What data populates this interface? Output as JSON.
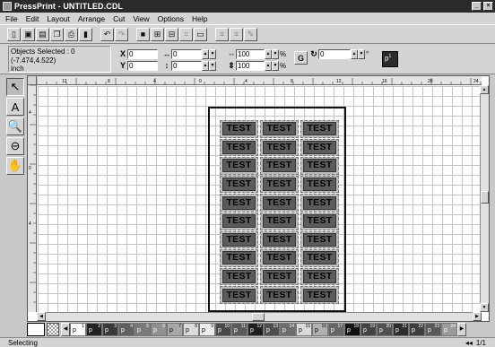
{
  "window": {
    "title": "PressPrint - UNTITLED.CDL",
    "minimize": "_",
    "close": "×"
  },
  "menu": [
    {
      "label": "File"
    },
    {
      "label": "Edit"
    },
    {
      "label": "Layout"
    },
    {
      "label": "Arrange"
    },
    {
      "label": "Cut"
    },
    {
      "label": "View"
    },
    {
      "label": "Options"
    },
    {
      "label": "Help"
    }
  ],
  "toolbar": {
    "icons": [
      "new-file-icon",
      "save-icon",
      "open-icon",
      "copy-icon",
      "print-icon",
      "clipboard-icon",
      "undo-icon",
      "redo-icon",
      "zoom-in-icon",
      "zoom-out-icon",
      "zoom-fit-icon",
      "group-icon",
      "frame-icon",
      "align-left-icon",
      "align-right-icon",
      "help-icon"
    ]
  },
  "properties": {
    "objects_selected": "Objects Selected : 0",
    "coords": "(-7.474,4.522)",
    "units": "inch",
    "x_label": "X",
    "x_value": "0",
    "y_label": "Y",
    "y_value": "0",
    "w_value": "0",
    "h_value": "0",
    "scale_w": "100",
    "scale_h": "100",
    "pct": "%",
    "lock_label": "G",
    "rotation": "0",
    "rotation_deg": "°"
  },
  "page_chip": {
    "label": "p",
    "number": "1"
  },
  "tools": [
    {
      "name": "pointer-tool-icon",
      "glyph": "↖",
      "active": true
    },
    {
      "name": "text-tool-icon",
      "glyph": "A",
      "active": false
    },
    {
      "name": "zoom-tool-icon",
      "glyph": "🔍",
      "active": false
    },
    {
      "name": "zoom-out-tool-icon",
      "glyph": "⊖",
      "active": false
    },
    {
      "name": "hand-tool-icon",
      "glyph": "✋",
      "active": false
    }
  ],
  "rulers": {
    "h_ticks": [
      "12",
      "8",
      "4",
      "0",
      "4",
      "8",
      "12",
      "16",
      "20",
      "24"
    ],
    "v_ticks": [
      "4",
      "0",
      "4"
    ]
  },
  "labels": {
    "text": "TEST",
    "rows": 10,
    "cols": 3
  },
  "palette": [
    {
      "num": "1",
      "color": "#ffffff"
    },
    {
      "num": "2",
      "color": "#222222"
    },
    {
      "num": "3",
      "color": "#3a3a3a"
    },
    {
      "num": "4",
      "color": "#606060"
    },
    {
      "num": "5",
      "color": "#7a7a7a"
    },
    {
      "num": "6",
      "color": "#909090"
    },
    {
      "num": "7",
      "color": "#a8a8a8"
    },
    {
      "num": "8",
      "color": "#dcdcdc"
    },
    {
      "num": "9",
      "color": "#ececec"
    },
    {
      "num": "10",
      "color": "#4a4a4a"
    },
    {
      "num": "11",
      "color": "#5a5a5a"
    },
    {
      "num": "12",
      "color": "#1e1e1e"
    },
    {
      "num": "13",
      "color": "#4e4e4e"
    },
    {
      "num": "14",
      "color": "#6e6e6e"
    },
    {
      "num": "15",
      "color": "#dadada"
    },
    {
      "num": "16",
      "color": "#b0b0b0"
    },
    {
      "num": "17",
      "color": "#666666"
    },
    {
      "num": "18",
      "color": "#111111"
    },
    {
      "num": "19",
      "color": "#444444"
    },
    {
      "num": "20",
      "color": "#505050"
    },
    {
      "num": "21",
      "color": "#2e2e2e"
    },
    {
      "num": "22",
      "color": "#3e3e3e"
    },
    {
      "num": "23",
      "color": "#585858"
    },
    {
      "num": "24",
      "color": "#9a9a9a"
    }
  ],
  "palette_swatch_label": "p",
  "status": {
    "text": "Selecting",
    "page": "1/1",
    "nav": "◂◂"
  }
}
